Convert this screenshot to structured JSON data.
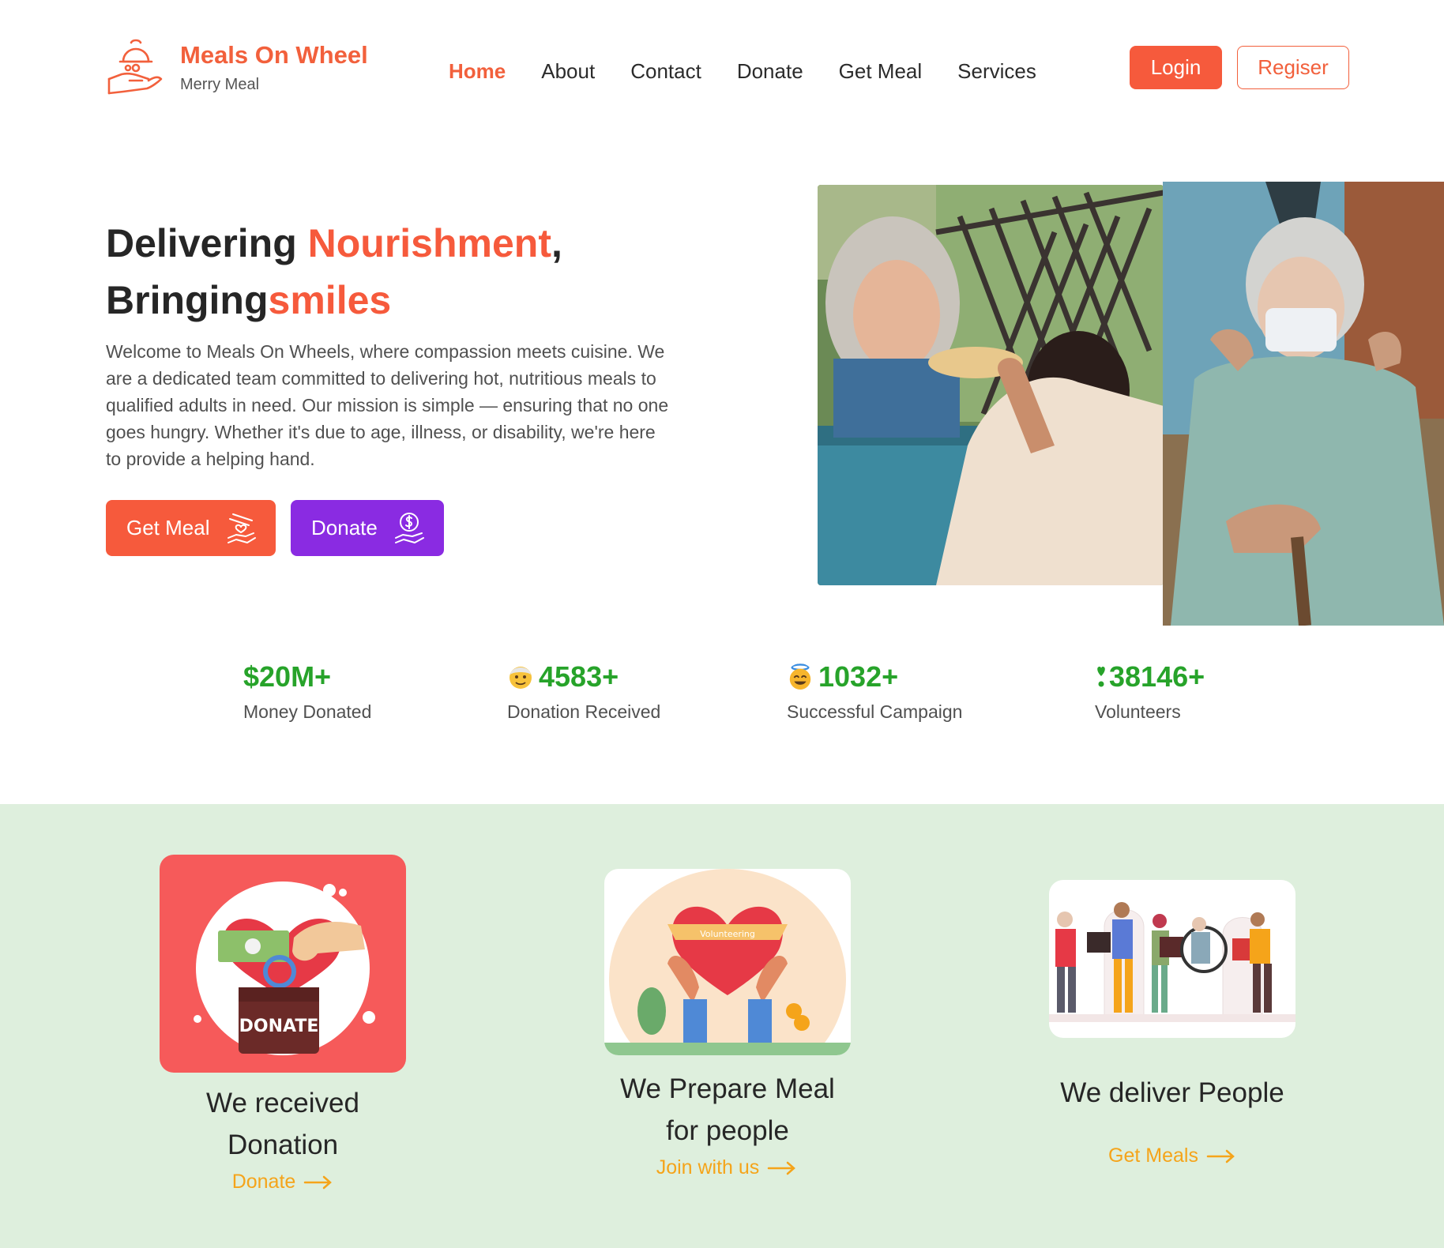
{
  "brand": {
    "title": "Meals On Wheel",
    "subtitle": "Merry Meal",
    "accent_color": "#f65a3c",
    "logo_icon": "hand-with-meal-icon"
  },
  "nav": {
    "items": [
      {
        "label": "Home",
        "active": true
      },
      {
        "label": "About",
        "active": false
      },
      {
        "label": "Contact",
        "active": false
      },
      {
        "label": "Donate",
        "active": false
      },
      {
        "label": "Get Meal",
        "active": false
      },
      {
        "label": "Services",
        "active": false
      }
    ],
    "login_label": "Login",
    "register_label": "Regiser"
  },
  "hero": {
    "title_part1": "Delivering ",
    "title_accent1": "Nourishment",
    "title_part2": ",",
    "title_part3": "Bringing",
    "title_accent2": "smiles",
    "description": "Welcome to Meals On Wheels, where compassion meets cuisine. We are a dedicated team committed to delivering hot, nutritious meals to qualified adults in need. Our mission is simple — ensuring that no one goes hungry. Whether it's due to age, illness, or disability, we're here to provide a helping hand.",
    "get_meal_label": "Get Meal",
    "donate_label": "Donate",
    "get_meal_color": "#f65a3c",
    "donate_color": "#8a2be2"
  },
  "stats": [
    {
      "value": "$20M+",
      "label": "Money Donated",
      "icon": ""
    },
    {
      "value": "4583+",
      "label": "Donation Received",
      "icon": "elderly-face-emoji"
    },
    {
      "value": "1032+",
      "label": "Successful Campaign",
      "icon": "smiling-halo-face-emoji"
    },
    {
      "value": "38146+",
      "label": "Volunteers",
      "icon": "heart-exclamation-icon"
    }
  ],
  "stats_color": "#27a32a",
  "process": {
    "background": "#deefdd",
    "cards": [
      {
        "title_line1": "We received",
        "title_line2": "Donation",
        "link": "Donate",
        "image_text": "DONATE"
      },
      {
        "title_line1": "We Prepare Meal",
        "title_line2": "for people",
        "link": "Join with us",
        "image_text": "Volunteering"
      },
      {
        "title_line1": "We deliver People",
        "title_line2": "",
        "link": "Get Meals"
      }
    ],
    "link_color": "#f5a41a"
  }
}
